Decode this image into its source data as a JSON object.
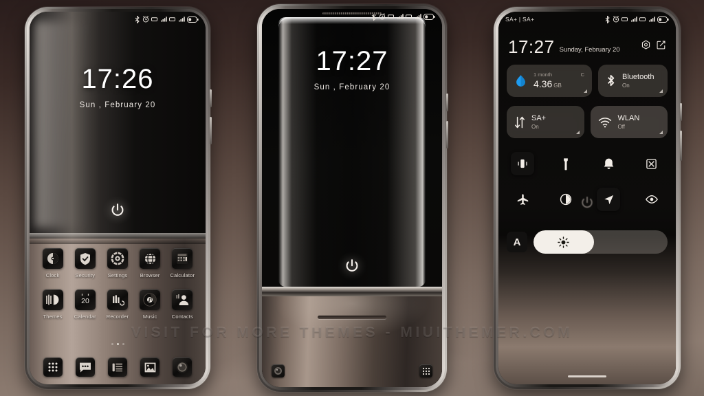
{
  "watermark": "VISIT FOR MORE THEMES - MIUITHEMER.COM",
  "phone1": {
    "statusbar": {
      "icons": [
        "bluetooth-icon",
        "alarm-icon",
        "sim1-icon",
        "signal1-icon",
        "sim2-icon",
        "signal2-icon",
        "battery-icon"
      ]
    },
    "lock": {
      "time": "17:26",
      "date": "Sun , February 20",
      "unlock": "power-icon"
    },
    "apps_row1": [
      {
        "label": "Clock",
        "icon": "clock-icon"
      },
      {
        "label": "Security",
        "icon": "shield-icon"
      },
      {
        "label": "Settings",
        "icon": "gear-icon"
      },
      {
        "label": "Browser",
        "icon": "globe-icon"
      },
      {
        "label": "Calculator",
        "icon": "calculator-icon"
      }
    ],
    "apps_row2": [
      {
        "label": "Themes",
        "icon": "themes-icon"
      },
      {
        "label": "Calendar",
        "icon": "calendar-icon"
      },
      {
        "label": "Recorder",
        "icon": "recorder-icon"
      },
      {
        "label": "Music",
        "icon": "music-icon"
      },
      {
        "label": "Contacts",
        "icon": "contacts-icon"
      }
    ],
    "calendar_day": "20",
    "pages": {
      "count": 3,
      "active": 1
    },
    "dock": [
      {
        "icon": "app-drawer-icon"
      },
      {
        "icon": "messages-icon"
      },
      {
        "icon": "phone-dialer-icon"
      },
      {
        "icon": "gallery-icon"
      },
      {
        "icon": "camera-icon"
      }
    ]
  },
  "phone2": {
    "statusbar": {
      "icons": [
        "bluetooth-icon",
        "alarm-icon",
        "sim1-icon",
        "signal1-icon",
        "sim2-icon",
        "signal2-icon",
        "battery-icon"
      ]
    },
    "lock": {
      "time": "17:27",
      "date": "Sun , February 20",
      "unlock": "power-icon"
    },
    "corner_left": "camera-icon",
    "corner_right": "app-drawer-icon"
  },
  "phone3": {
    "statusbar": {
      "carrier": "SA+ | SA+",
      "icons": [
        "bluetooth-icon",
        "alarm-icon",
        "sim1-icon",
        "signal1-icon",
        "sim2-icon",
        "signal2-icon",
        "battery-icon"
      ]
    },
    "header": {
      "time": "17:27",
      "date": "Sunday, February 20",
      "settings_icon": "gear-icon",
      "edit_icon": "edit-icon"
    },
    "tiles": [
      {
        "name": "data-usage",
        "top_label": "1 month",
        "top_right": "C",
        "value": "4.36",
        "unit": "GB",
        "icon": "data-drop-icon",
        "accent": "#1e9bf0"
      },
      {
        "name": "bluetooth",
        "title": "Bluetooth",
        "state": "On",
        "icon": "bluetooth-icon"
      },
      {
        "name": "mobile-data",
        "title": "SA+",
        "state": "On",
        "icon": "data-arrows-icon"
      },
      {
        "name": "wlan",
        "title": "WLAN",
        "state": "Off",
        "icon": "wifi-icon"
      }
    ],
    "toggles_row1": [
      {
        "name": "vibrate",
        "icon": "vibrate-icon",
        "active": true
      },
      {
        "name": "flashlight",
        "icon": "flashlight-icon",
        "active": false
      },
      {
        "name": "ringer",
        "icon": "bell-icon",
        "active": false
      },
      {
        "name": "screenshot",
        "icon": "screenshot-icon",
        "active": false
      }
    ],
    "toggles_row2": [
      {
        "name": "airplane-mode",
        "icon": "airplane-icon",
        "active": false
      },
      {
        "name": "dark-mode",
        "icon": "contrast-icon",
        "active": false
      },
      {
        "name": "location",
        "icon": "location-arrow-icon",
        "active": true
      },
      {
        "name": "eye-care",
        "icon": "eye-icon",
        "active": false
      }
    ],
    "brightness": {
      "auto_label": "A",
      "icon": "sun-icon",
      "percent": 45
    }
  }
}
